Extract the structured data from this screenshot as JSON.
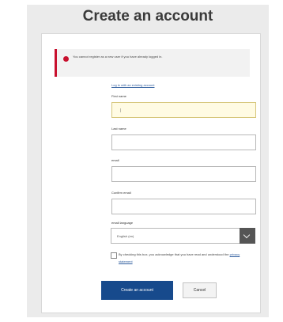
{
  "page": {
    "title": "Create an account"
  },
  "alert": {
    "icon": "error-icon",
    "color": "#c8102e",
    "message": "You cannot register as a new user if you have already logged in."
  },
  "form": {
    "already_link": "Log in with an existing account",
    "first_name": {
      "label": "First name",
      "value": ""
    },
    "last_name": {
      "label": "Last name",
      "value": ""
    },
    "email": {
      "label": "email",
      "value": ""
    },
    "confirm_email": {
      "label": "Confirm email",
      "value": ""
    },
    "language": {
      "label": "email language",
      "selected": "English (en)",
      "toggle_icon": "chevron-down-icon"
    },
    "consent": {
      "text": "By checking this box, you acknowledge that you have read and understood the",
      "link": "privacy statement"
    }
  },
  "buttons": {
    "create": "Create an account",
    "cancel": "Cancel"
  },
  "colors": {
    "primary": "#174a8c",
    "alert": "#c8102e",
    "active_field": "#fffbe3"
  }
}
